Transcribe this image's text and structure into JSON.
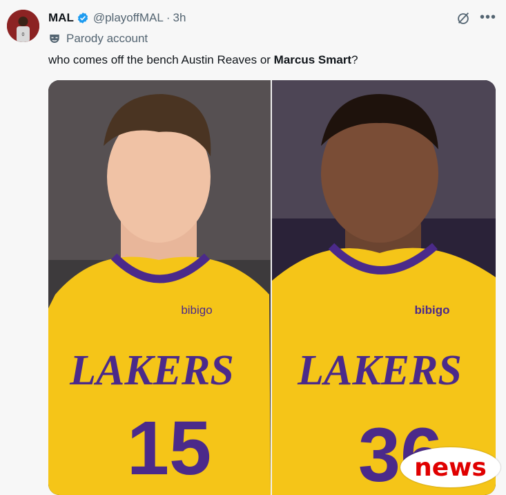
{
  "author": {
    "name": "MAL",
    "handle": "@playoffMAL",
    "separator": "·",
    "time": "3h",
    "verified": true,
    "badge_label": "Parody account"
  },
  "post": {
    "text_before": "who comes off the bench Austin Reaves or ",
    "text_bold": "Marcus Smart",
    "text_after": "?"
  },
  "media": {
    "left_player": {
      "team": "LAKERS",
      "number": "15",
      "sponsor": "bibigo"
    },
    "right_player": {
      "team": "LAKERS",
      "number": "36",
      "sponsor": "bibigo"
    },
    "watermark": "news"
  },
  "icons": {
    "verified": "verified-badge-icon",
    "parody": "parody-mask-icon",
    "grok": "grok-icon",
    "more": "more-options-icon"
  },
  "colors": {
    "accent": "#1d9bf0",
    "lakers_gold": "#f5c518",
    "lakers_purple": "#4b2a8a",
    "watermark_red": "#e00000"
  }
}
